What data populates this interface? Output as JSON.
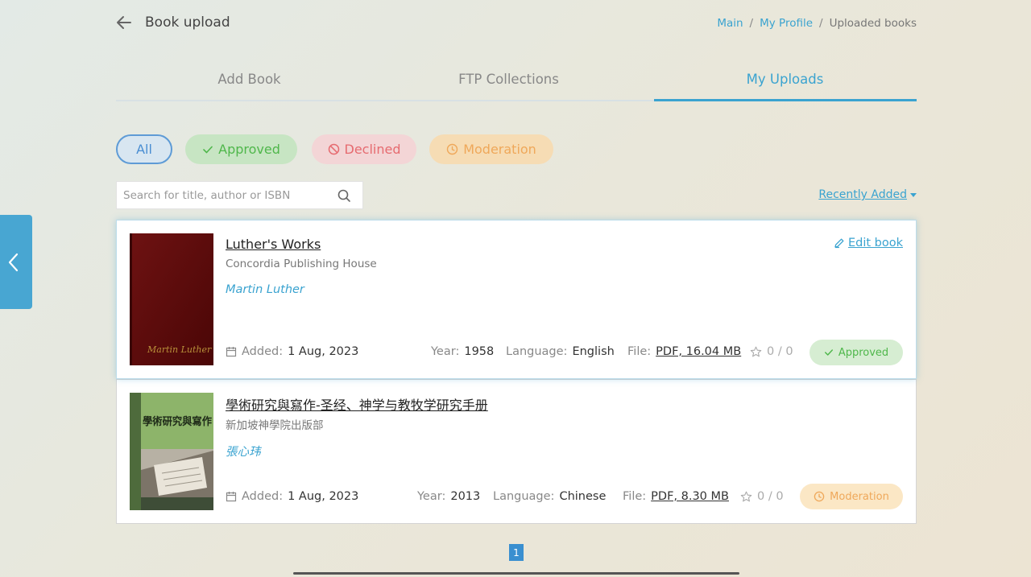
{
  "header": {
    "title": "Book upload",
    "breadcrumb": {
      "main": "Main",
      "profile": "My Profile",
      "current": "Uploaded books",
      "separator": "/"
    }
  },
  "tabs": [
    {
      "label": "Add Book",
      "active": false
    },
    {
      "label": "FTP Collections",
      "active": false
    },
    {
      "label": "My Uploads",
      "active": true
    }
  ],
  "filters": {
    "all": "All",
    "approved": "Approved",
    "declined": "Declined",
    "moderation": "Moderation"
  },
  "search": {
    "placeholder": "Search for title, author or ISBN",
    "value": ""
  },
  "sort": {
    "label": "Recently Added"
  },
  "labels": {
    "added": "Added:",
    "year": "Year:",
    "language": "Language:",
    "file": "File:",
    "edit": "Edit book"
  },
  "books": [
    {
      "title": "Luther's Works",
      "publisher": "Concordia Publishing House",
      "author": "Martin Luther",
      "added": "1 Aug, 2023",
      "year": "1958",
      "language": "English",
      "file": "PDF, 16.04 MB",
      "rating": "0 / 0",
      "status": "Approved",
      "cover_signature": "Martin Luther"
    },
    {
      "title": "學術研究與寫作-圣经、神学与教牧学研究手册",
      "publisher": "新加坡神學院出版部",
      "author": "張心玮",
      "added": "1 Aug, 2023",
      "year": "2013",
      "language": "Chinese",
      "file": "PDF, 8.30 MB",
      "rating": "0 / 0",
      "status": "Moderation",
      "cover_text": "學術研究與寫作"
    }
  ],
  "pagination": {
    "current": "1"
  },
  "colors": {
    "accent": "#3aa3d0",
    "approved": "#4fb74b",
    "declined": "#e66b70",
    "moderation": "#efa85a"
  }
}
